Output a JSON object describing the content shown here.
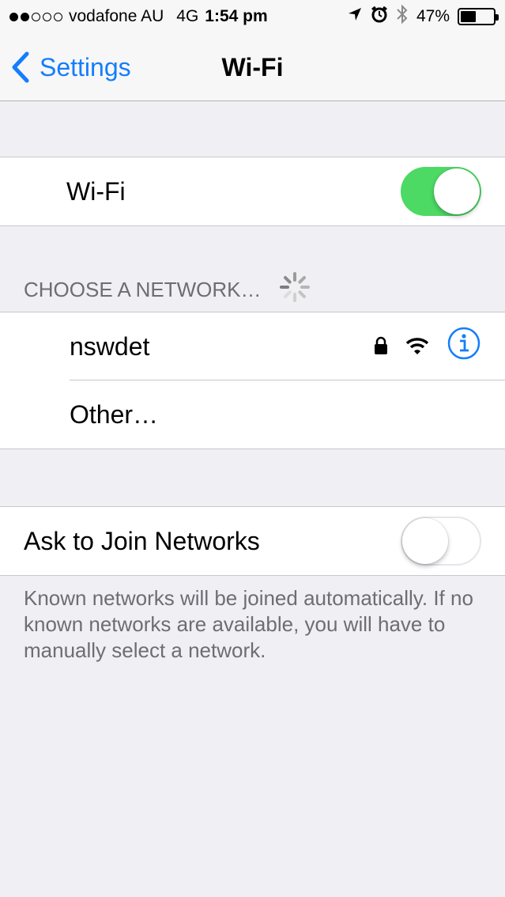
{
  "status_bar": {
    "signal_dots_filled": 2,
    "signal_dots_total": 5,
    "carrier": "vodafone AU",
    "network": "4G",
    "time": "1:54 pm",
    "battery_percent": "47%",
    "battery_level": 0.47
  },
  "nav": {
    "back_label": "Settings",
    "title": "Wi-Fi"
  },
  "wifi_toggle": {
    "label": "Wi-Fi",
    "state": "on"
  },
  "networks": {
    "header": "CHOOSE A NETWORK…",
    "items": [
      {
        "name": "nswdet",
        "secured": true
      },
      {
        "name": "Other…"
      }
    ]
  },
  "ask_to_join": {
    "label": "Ask to Join Networks",
    "state": "off",
    "footer": "Known networks will be joined automatically. If no known networks are available, you will have to manually select a network."
  },
  "colors": {
    "accent": "#147efb",
    "toggle_on": "#4cd964",
    "background": "#efeff4"
  }
}
